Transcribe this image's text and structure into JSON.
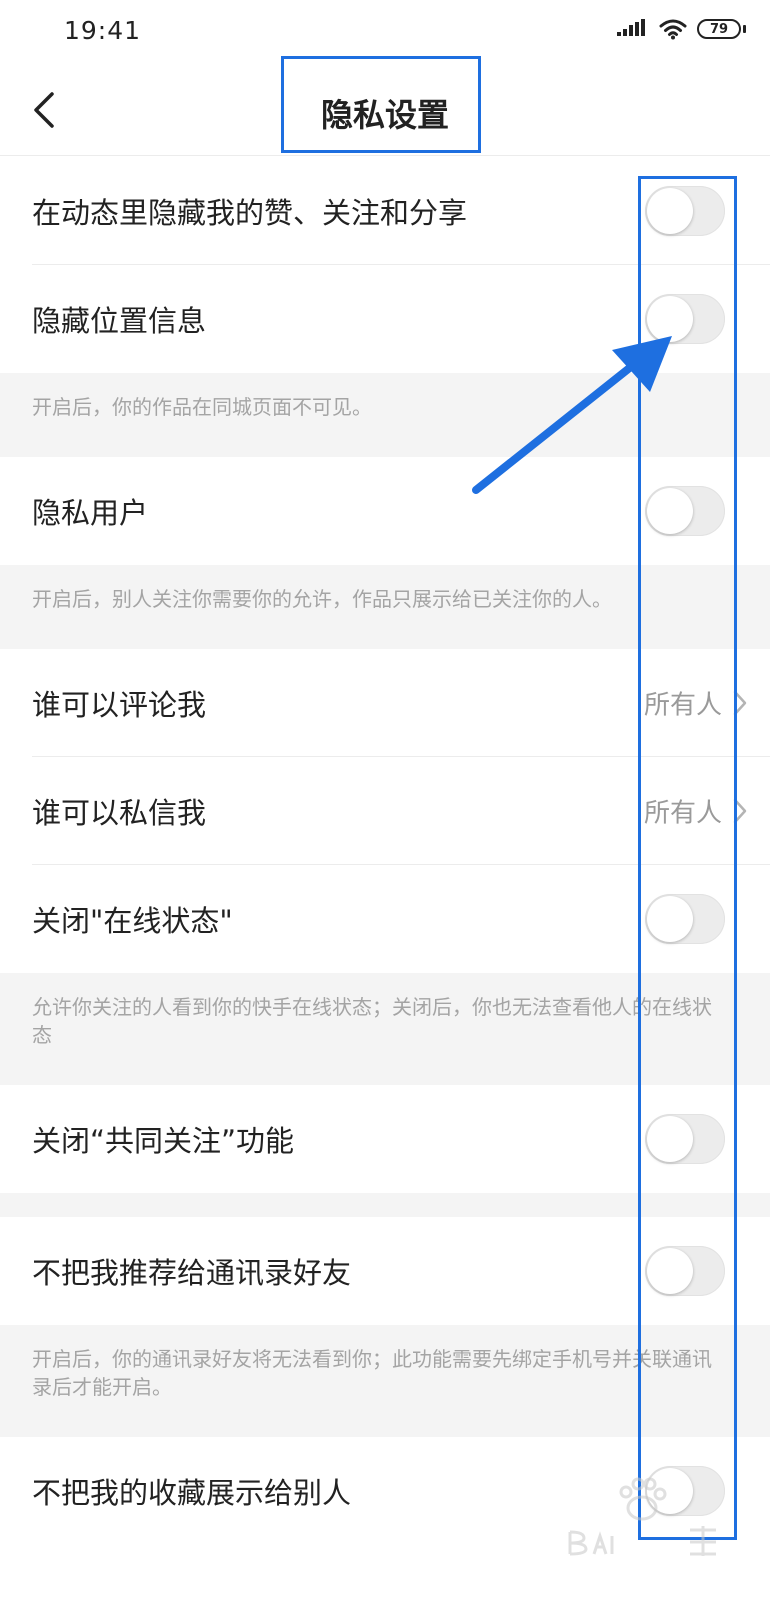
{
  "status_bar": {
    "time": "19:41",
    "battery": "79"
  },
  "nav": {
    "title": "隐私设置",
    "back_icon": "chevron-left-icon"
  },
  "settings": {
    "hide_likes": {
      "label": "在动态里隐藏我的赞、关注和分享",
      "enabled": false
    },
    "hide_location": {
      "label": "隐藏位置信息",
      "enabled": false
    },
    "hide_location_note": "开启后，你的作品在同城页面不可见。",
    "private_user": {
      "label": "隐私用户",
      "enabled": false
    },
    "private_user_note": "开启后，别人关注你需要你的允许，作品只展示给已关注你的人。",
    "who_can_comment": {
      "label": "谁可以评论我",
      "value": "所有人"
    },
    "who_can_message": {
      "label": "谁可以私信我",
      "value": "所有人"
    },
    "online_status": {
      "label": "关闭\"在线状态\"",
      "enabled": false
    },
    "online_status_note": "允许你关注的人看到你的快手在线状态；关闭后，你也无法查看他人的在线状态",
    "mutual_follow": {
      "label": "关闭“共同关注”功能",
      "enabled": false
    },
    "contacts_recommend": {
      "label": "不把我推荐给通讯录好友",
      "enabled": false
    },
    "contacts_recommend_note": "开启后，你的通讯录好友将无法看到你；此功能需要先绑定手机号并关联通讯录后才能开启。",
    "hide_favorites": {
      "label": "不把我的收藏展示给别人",
      "enabled": false
    }
  },
  "colors": {
    "annotation": "#1e6fe0",
    "toggle_off": "#ececec",
    "note_background": "#f4f4f4"
  }
}
